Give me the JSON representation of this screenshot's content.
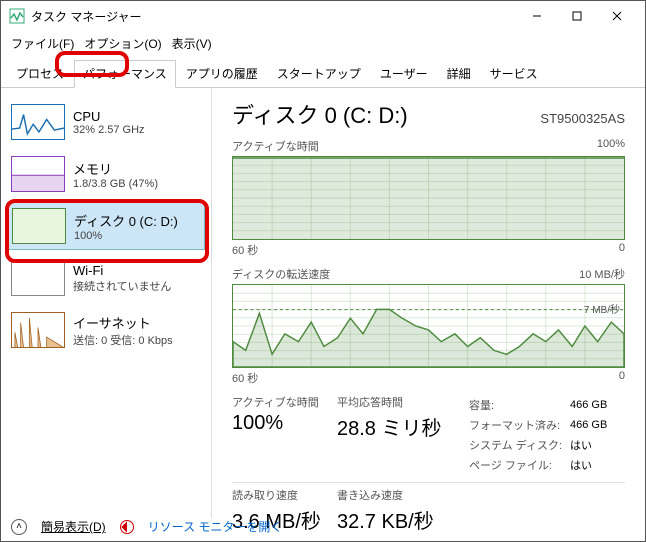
{
  "window": {
    "title": "タスク マネージャー"
  },
  "menu": {
    "file": "ファイル(F)",
    "options": "オプション(O)",
    "view": "表示(V)"
  },
  "tabs": {
    "items": [
      "プロセス",
      "パフォーマンス",
      "アプリの履歴",
      "スタートアップ",
      "ユーザー",
      "詳細",
      "サービス"
    ],
    "selected_index": 1
  },
  "sidebar": {
    "cpu": {
      "title": "CPU",
      "sub": "32%  2.57 GHz"
    },
    "memory": {
      "title": "メモリ",
      "sub": "1.8/3.8 GB (47%)"
    },
    "disk": {
      "title": "ディスク 0 (C: D:)",
      "sub": "100%"
    },
    "wifi": {
      "title": "Wi-Fi",
      "sub": "接続されていません"
    },
    "ethernet": {
      "title": "イーサネット",
      "sub": "送信: 0 受信: 0 Kbps"
    }
  },
  "main": {
    "title": "ディスク 0 (C: D:)",
    "model": "ST9500325AS",
    "chart1": {
      "label": "アクティブな時間",
      "max": "100%",
      "xleft": "60 秒",
      "xright": "0"
    },
    "chart2": {
      "label": "ディスクの転送速度",
      "max": "10 MB/秒",
      "xleft": "60 秒",
      "xright": "0",
      "mid_label": "7 MB/秒"
    },
    "stats": {
      "active_time": {
        "label": "アクティブな時間",
        "value": "100%"
      },
      "avg_response": {
        "label": "平均応答時間",
        "value": "28.8 ミリ秒"
      },
      "read_speed": {
        "label": "読み取り速度",
        "value": "3.6 MB/秒"
      },
      "write_speed": {
        "label": "書き込み速度",
        "value": "32.7 KB/秒"
      }
    },
    "info": {
      "capacity_label": "容量:",
      "capacity": "466 GB",
      "formatted_label": "フォーマット済み:",
      "formatted": "466 GB",
      "system_disk_label": "システム ディスク:",
      "system_disk": "はい",
      "page_file_label": "ページ ファイル:",
      "page_file": "はい"
    }
  },
  "footer": {
    "simple_view": "簡易表示(D)",
    "resource_monitor": "リソース モニターを開く"
  },
  "chart_data": [
    {
      "type": "area",
      "title": "アクティブな時間",
      "xlabel": "秒",
      "ylabel": "%",
      "xlim": [
        0,
        60
      ],
      "ylim": [
        0,
        100
      ],
      "x": [
        0,
        5,
        10,
        15,
        20,
        25,
        30,
        35,
        40,
        45,
        50,
        55,
        60
      ],
      "values": [
        100,
        100,
        100,
        100,
        100,
        100,
        100,
        100,
        100,
        100,
        100,
        100,
        100
      ]
    },
    {
      "type": "line",
      "title": "ディスクの転送速度",
      "xlabel": "秒",
      "ylabel": "MB/秒",
      "xlim": [
        0,
        60
      ],
      "ylim": [
        0,
        10
      ],
      "series": [
        {
          "name": "転送速度",
          "x": [
            0,
            2,
            4,
            6,
            8,
            10,
            12,
            14,
            16,
            18,
            20,
            22,
            24,
            26,
            28,
            30,
            32,
            34,
            36,
            38,
            40,
            42,
            44,
            46,
            48,
            50,
            52,
            54,
            56,
            58,
            60
          ],
          "values": [
            3.0,
            2.0,
            6.5,
            1.5,
            4.0,
            3.0,
            5.5,
            2.5,
            3.5,
            6.0,
            4.0,
            7.0,
            7.0,
            6.0,
            5.0,
            4.5,
            3.0,
            4.0,
            2.5,
            3.5,
            2.0,
            1.5,
            2.5,
            4.0,
            3.0,
            4.5,
            2.5,
            5.0,
            3.0,
            5.5,
            4.0
          ]
        }
      ]
    }
  ]
}
